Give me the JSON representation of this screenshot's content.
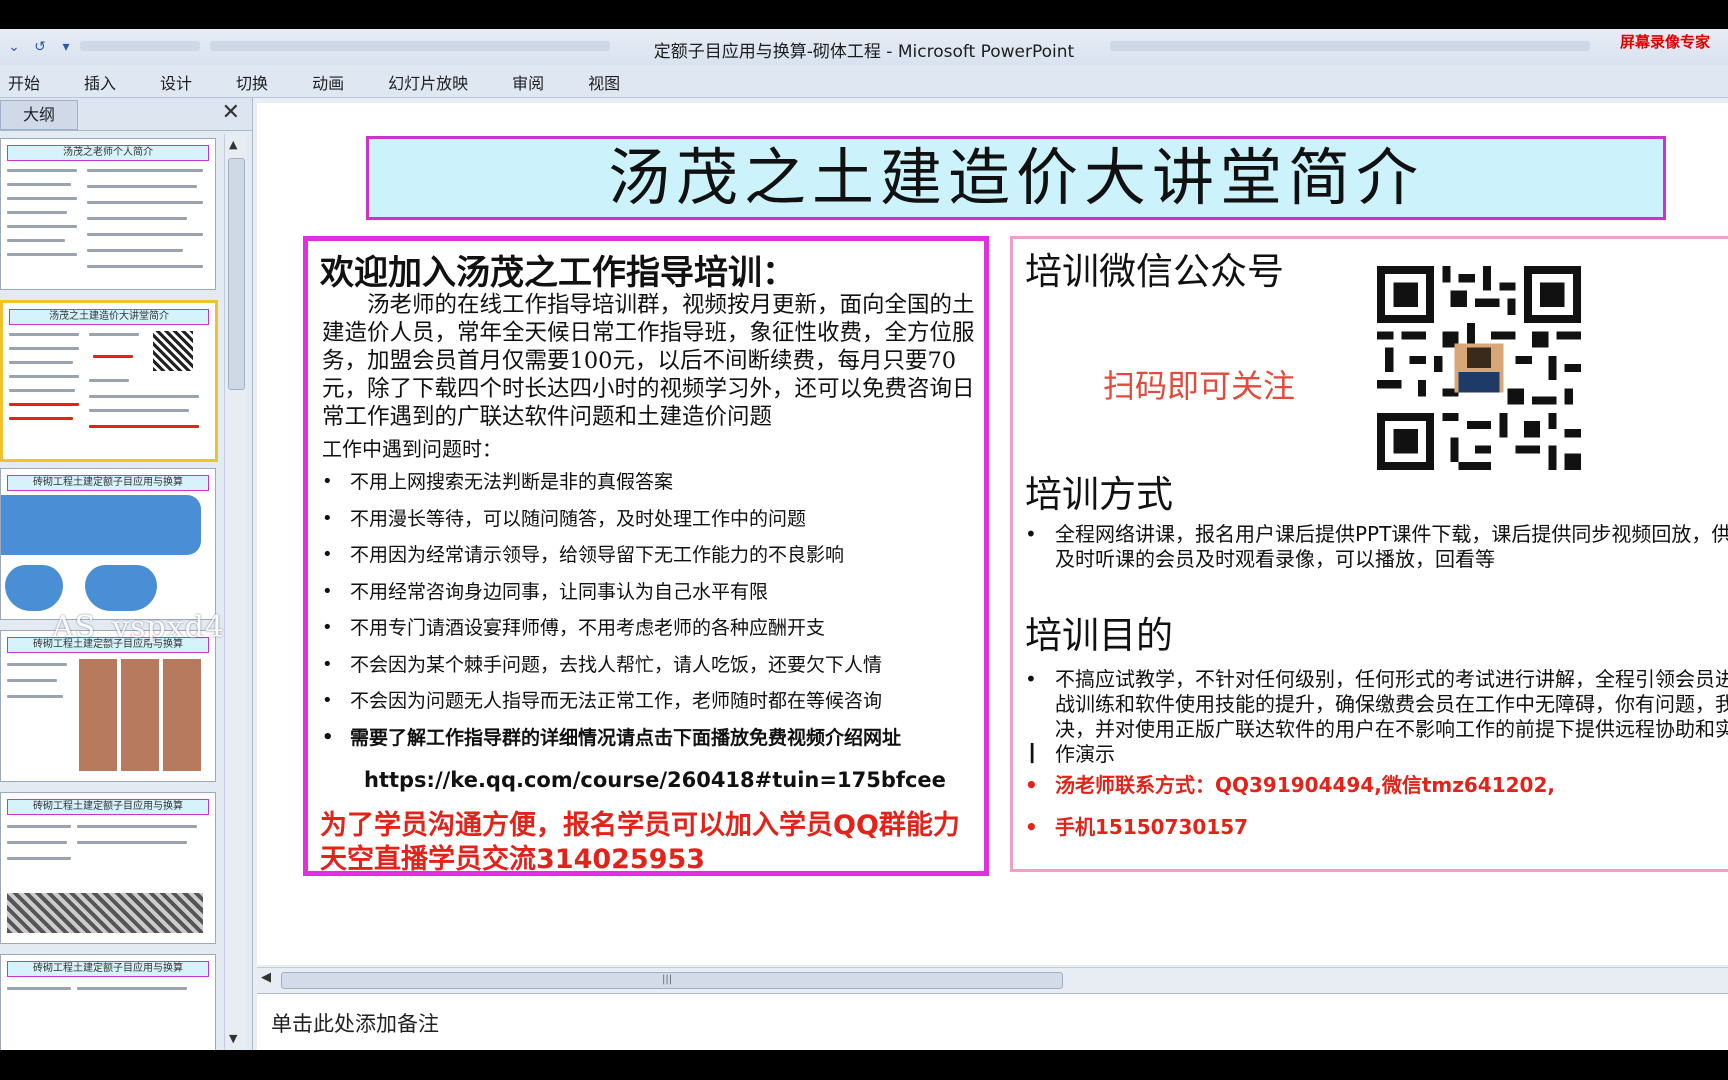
{
  "window": {
    "title": "定额子目应用与换算-砌体工程 - Microsoft PowerPoint",
    "recorder_brand": "屏幕录像专家"
  },
  "ribbon": {
    "tabs": [
      "开始",
      "插入",
      "设计",
      "切换",
      "动画",
      "幻灯片放映",
      "审阅",
      "视图"
    ]
  },
  "left_panel": {
    "tab_label": "大纲",
    "thumbnails": [
      {
        "title": "汤茂之老师个人简介"
      },
      {
        "title": "汤茂之土建造价大讲堂简介",
        "selected": true
      },
      {
        "title": "砖砌工程土建定额子目应用与换算"
      },
      {
        "title": "砖砌工程土建定额子目应用与换算"
      },
      {
        "title": "砖砌工程土建定额子目应用与换算"
      },
      {
        "title": "砖砌工程土建定额子目应用与换算"
      }
    ],
    "watermark": "AS_vspxd4"
  },
  "slide": {
    "title": "汤茂之土建造价大讲堂简介",
    "left": {
      "heading": "欢迎加入汤茂之工作指导培训：",
      "paragraph": "　　汤老师的在线工作指导培训群，视频按月更新，面向全国的土建造价人员，常年全天候日常工作指导班，象征性收费，全方位服务，加盟会员首月仅需要100元，以后不间断续费，每月只要70元，除了下载四个时长达四小时的视频学习外，还可以免费咨询日常工作遇到的广联达软件问题和土建造价问题",
      "subheading": "工作中遇到问题时：",
      "bullets": [
        "不用上网搜索无法判断是非的真假答案",
        "不用漫长等待，可以随问随答，及时处理工作中的问题",
        "不用因为经常请示领导，给领导留下无工作能力的不良影响",
        "不用经常咨询身边同事，让同事认为自己水平有限",
        "不用专门请酒设宴拜师傅，不用考虑老师的各种应酬开支",
        "不会因为某个棘手问题，去找人帮忙，请人吃饭，还要欠下人情",
        "不会因为问题无人指导而无法正常工作，老师随时都在等候咨询",
        "需要了解工作指导群的详细情况请点击下面播放免费视频介绍网址"
      ],
      "url": "https://ke.qq.com/course/260418#tuin=175bfcee",
      "red_note": "为了学员沟通方便，报名学员可以加入学员QQ群能力天空直播学员交流314025953"
    },
    "right": {
      "wechat_heading": "培训微信公众号",
      "scan_text": "扫码即可关注",
      "method_heading": "培训方式",
      "method_text": "全程网络讲课，报名用户课后提供PPT课件下载，课后提供同步视频回放，供没有及时听课的会员及时观看录像，可以播放，回看等",
      "purpose_heading": "培训目的",
      "purpose_text": "不搞应试教学，不针对任何级别，任何形式的考试进行讲解，全程引领会员进行实战训练和软件使用技能的提升，确保缴费会员在工作中无障碍，你有问题，我来解决，并对使用正版广联达软件的用户在不影响工作的前提下提供远程协助和实战操作演示",
      "contact": "汤老师联系方式：QQ391904494,微信tmz641202,",
      "phone": "手机15150730157"
    }
  },
  "notes": {
    "placeholder": "单击此处添加备注"
  },
  "colors": {
    "title_fill": "#ccf3fb",
    "box_border": "#e22fe2",
    "accent_red": "#e2231a"
  }
}
